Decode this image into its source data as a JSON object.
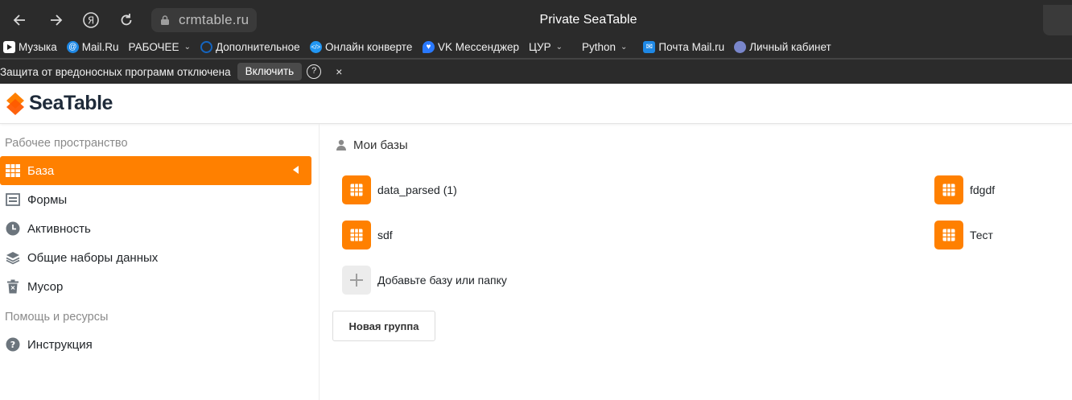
{
  "browser": {
    "url": "crmtable.ru",
    "page_title": "Private SeaTable",
    "bookmarks": [
      {
        "label": "Музыка",
        "icon": "play-icon",
        "color": "#ffffff",
        "dropdown": false
      },
      {
        "label": "Mail.Ru",
        "icon": "at-icon",
        "color": "#1e88e5",
        "dropdown": false
      },
      {
        "label": "РАБОЧЕЕ",
        "icon": "",
        "color": "",
        "dropdown": true
      },
      {
        "label": "Дополнительное",
        "icon": "globe-icon",
        "color": "#1565c0",
        "dropdown": false
      },
      {
        "label": "Онлайн конверте",
        "icon": "code-icon",
        "color": "#2196f3",
        "dropdown": false
      },
      {
        "label": "VK Мессенджер",
        "icon": "vk-chat-icon",
        "color": "#2979ff",
        "dropdown": false
      },
      {
        "label": "ЦУР",
        "icon": "",
        "color": "",
        "dropdown": true
      },
      {
        "label": "Python",
        "icon": "",
        "color": "",
        "dropdown": true
      },
      {
        "label": "Почта Mail.ru",
        "icon": "mail-icon",
        "color": "#1e88e5",
        "dropdown": false
      },
      {
        "label": "Личный кабинет",
        "icon": "profile-icon",
        "color": "#7986cb",
        "dropdown": false
      }
    ],
    "warning": {
      "text": "Защита от вредоносных программ отключена",
      "button": "Включить",
      "help": "?",
      "close": "×"
    }
  },
  "app": {
    "logo_text": "SeaTable",
    "brand_color": "#ff8000"
  },
  "sidebar": {
    "workspace_heading": "Рабочее пространство",
    "items": [
      {
        "label": "База",
        "icon": "grid-icon",
        "active": true
      },
      {
        "label": "Формы",
        "icon": "form-icon",
        "active": false
      },
      {
        "label": "Активность",
        "icon": "clock-icon",
        "active": false
      },
      {
        "label": "Общие наборы данных",
        "icon": "layers-icon",
        "active": false
      },
      {
        "label": "Мусор",
        "icon": "trash-icon",
        "active": false
      }
    ],
    "help_heading": "Помощь и ресурсы",
    "help_items": [
      {
        "label": "Инструкция",
        "icon": "help-icon"
      }
    ]
  },
  "main": {
    "section_title": "Мои базы",
    "bases": [
      "data_parsed (1)",
      "fdgdf",
      "sdf",
      "Тест"
    ],
    "add_label": "Добавьте базу или папку",
    "new_group_label": "Новая группа"
  }
}
